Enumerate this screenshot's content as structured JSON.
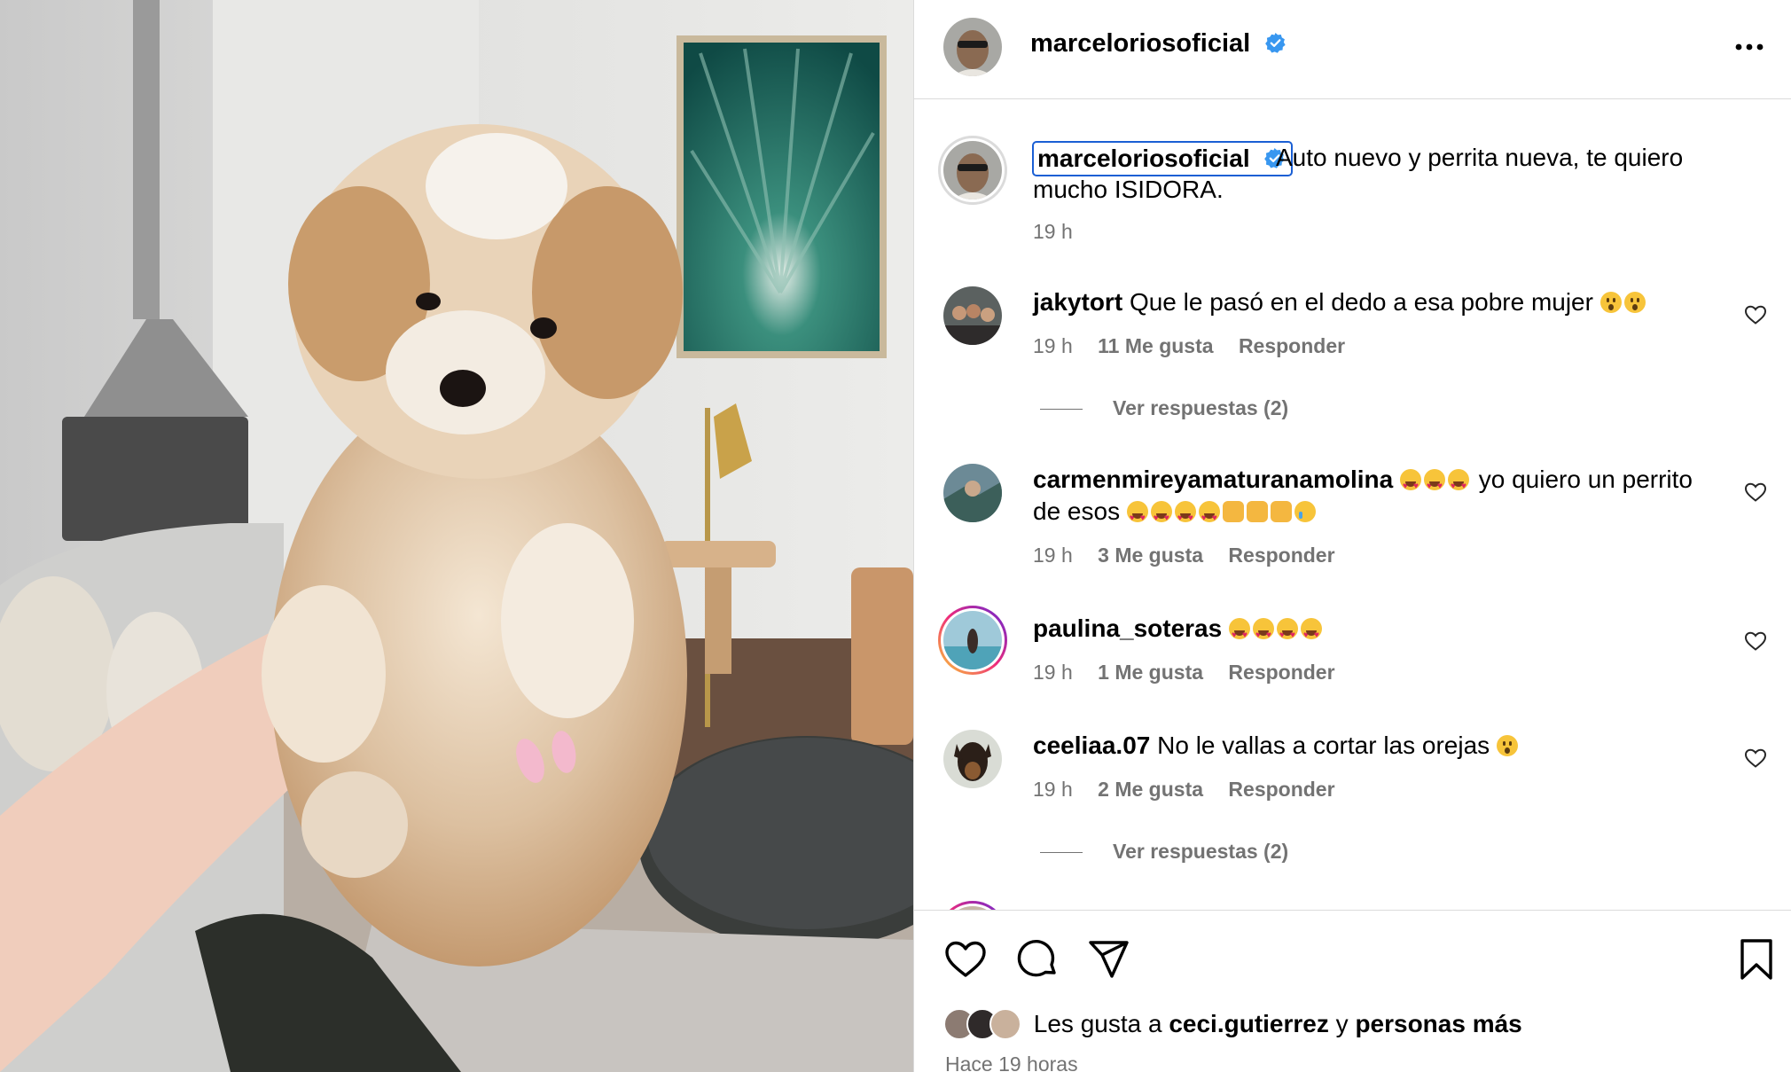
{
  "post": {
    "username": "marceloriosoficial",
    "verified": true,
    "caption": "Auto nuevo y perrita nueva, te quiero mucho ISIDORA.",
    "caption_line1": "Auto nuevo y perrita nueva, te quiero",
    "caption_line2": "mucho ISIDORA.",
    "caption_time": "19 h",
    "more_icon": "more-horizontal-icon"
  },
  "comments": [
    {
      "username": "jakytort",
      "text": "Que le pasó en el dedo a esa pobre mujer 😮😮",
      "line1": "Que le pasó en el dedo a esa pobre mujer",
      "time": "19 h",
      "likes": "11 Me gusta",
      "reply": "Responder",
      "view_replies": "Ver respuestas (2)"
    },
    {
      "username": "carmenmireyamaturanamolina",
      "text": "😍😍😍 yo quiero un perrito de esos 😍😍😍😍🙌🙌🙌😢",
      "line1": "yo quiero un perrito",
      "line2": "de esos",
      "time": "19 h",
      "likes": "3 Me gusta",
      "reply": "Responder"
    },
    {
      "username": "paulina_soteras",
      "text": "😍😍😍😍",
      "time": "19 h",
      "likes": "1 Me gusta",
      "reply": "Responder"
    },
    {
      "username": "ceeliaa.07",
      "text": "No le vallas a cortar las orejas 😮",
      "line1": "No le vallas a cortar las orejas",
      "time": "19 h",
      "likes": "2 Me gusta",
      "reply": "Responder",
      "view_replies": "Ver respuestas (2)"
    }
  ],
  "footer": {
    "likes_prefix": "Les gusta a",
    "likes_user": "ceci.gutierrez",
    "likes_conj": "y",
    "likes_more": "personas más",
    "posted_ago": "Hace 19 horas"
  },
  "icons": [
    "heart-icon",
    "comment-icon",
    "share-icon",
    "bookmark-icon"
  ],
  "colors": {
    "verified": "#3897f0",
    "muted_text": "#737373",
    "border": "#dbdbdb",
    "focus_outline": "#1a5fd4"
  }
}
